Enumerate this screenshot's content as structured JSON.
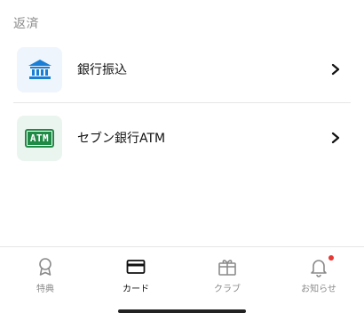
{
  "section": {
    "title": "返済"
  },
  "rows": [
    {
      "label": "銀行振込",
      "icon": "bank-icon"
    },
    {
      "label": "セブン銀行ATM",
      "icon": "atm-icon",
      "badge_text": "ATM"
    }
  ],
  "tabs": [
    {
      "label": "特典",
      "icon": "award-icon"
    },
    {
      "label": "カード",
      "icon": "card-icon",
      "active": true
    },
    {
      "label": "クラブ",
      "icon": "gift-icon"
    },
    {
      "label": "お知らせ",
      "icon": "bell-icon",
      "has_notification": true
    }
  ],
  "colors": {
    "bank_blue": "#1a7fd4",
    "atm_green": "#1e8a45",
    "notification_red": "#e53935"
  }
}
